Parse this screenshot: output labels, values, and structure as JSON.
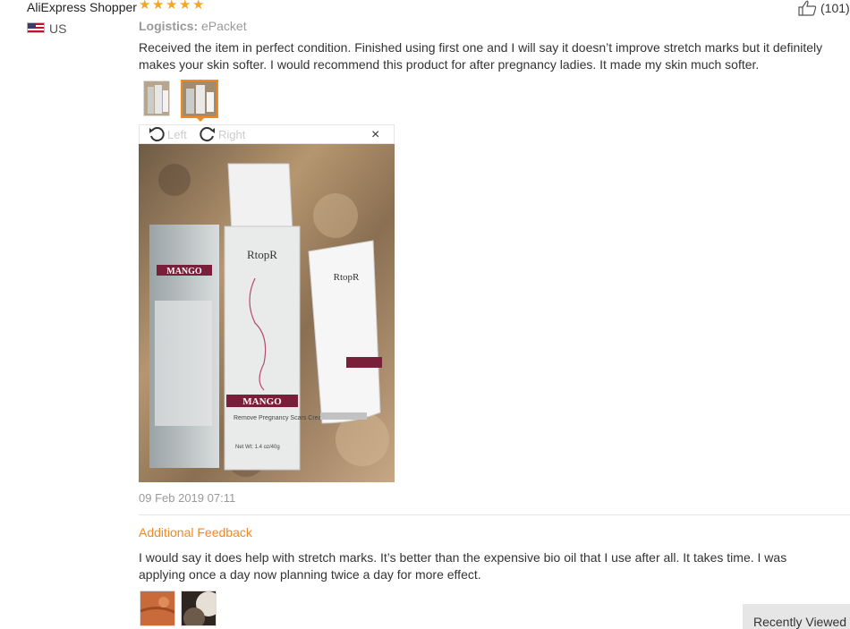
{
  "review": {
    "reviewer": "AliExpress Shopper",
    "rating": 5,
    "country": "US",
    "helpful_count": "(101)",
    "logistics_label": "Logistics:",
    "logistics_value": "ePacket",
    "text": "Received the item in perfect condition. Finished using first one and I will say it doesn’t improve stretch marks but it definitely makes your skin softer. I would recommend this product for after pregnancy ladies. It made my skin much softer.",
    "date": "09 Feb 2019 07:11"
  },
  "viewer": {
    "rotate_left": "Left",
    "rotate_right": "Right",
    "close": "×"
  },
  "product": {
    "brand": "RtopR",
    "name": "MANGO",
    "subtitle": "Remove Pregnancy Scars Cream",
    "net_wt": "Net Wt: 1.4 oz/40g"
  },
  "additional": {
    "title": "Additional Feedback",
    "text": "I would say it does help with stretch marks. It’s better than the expensive bio oil that I use after all. It takes time. I was applying once a day now planning twice a day for more effect."
  },
  "footer": {
    "recently_viewed": "Recently Viewed"
  },
  "colors": {
    "accent": "#f08a24",
    "star": "#f5a623",
    "muted": "#999999"
  }
}
